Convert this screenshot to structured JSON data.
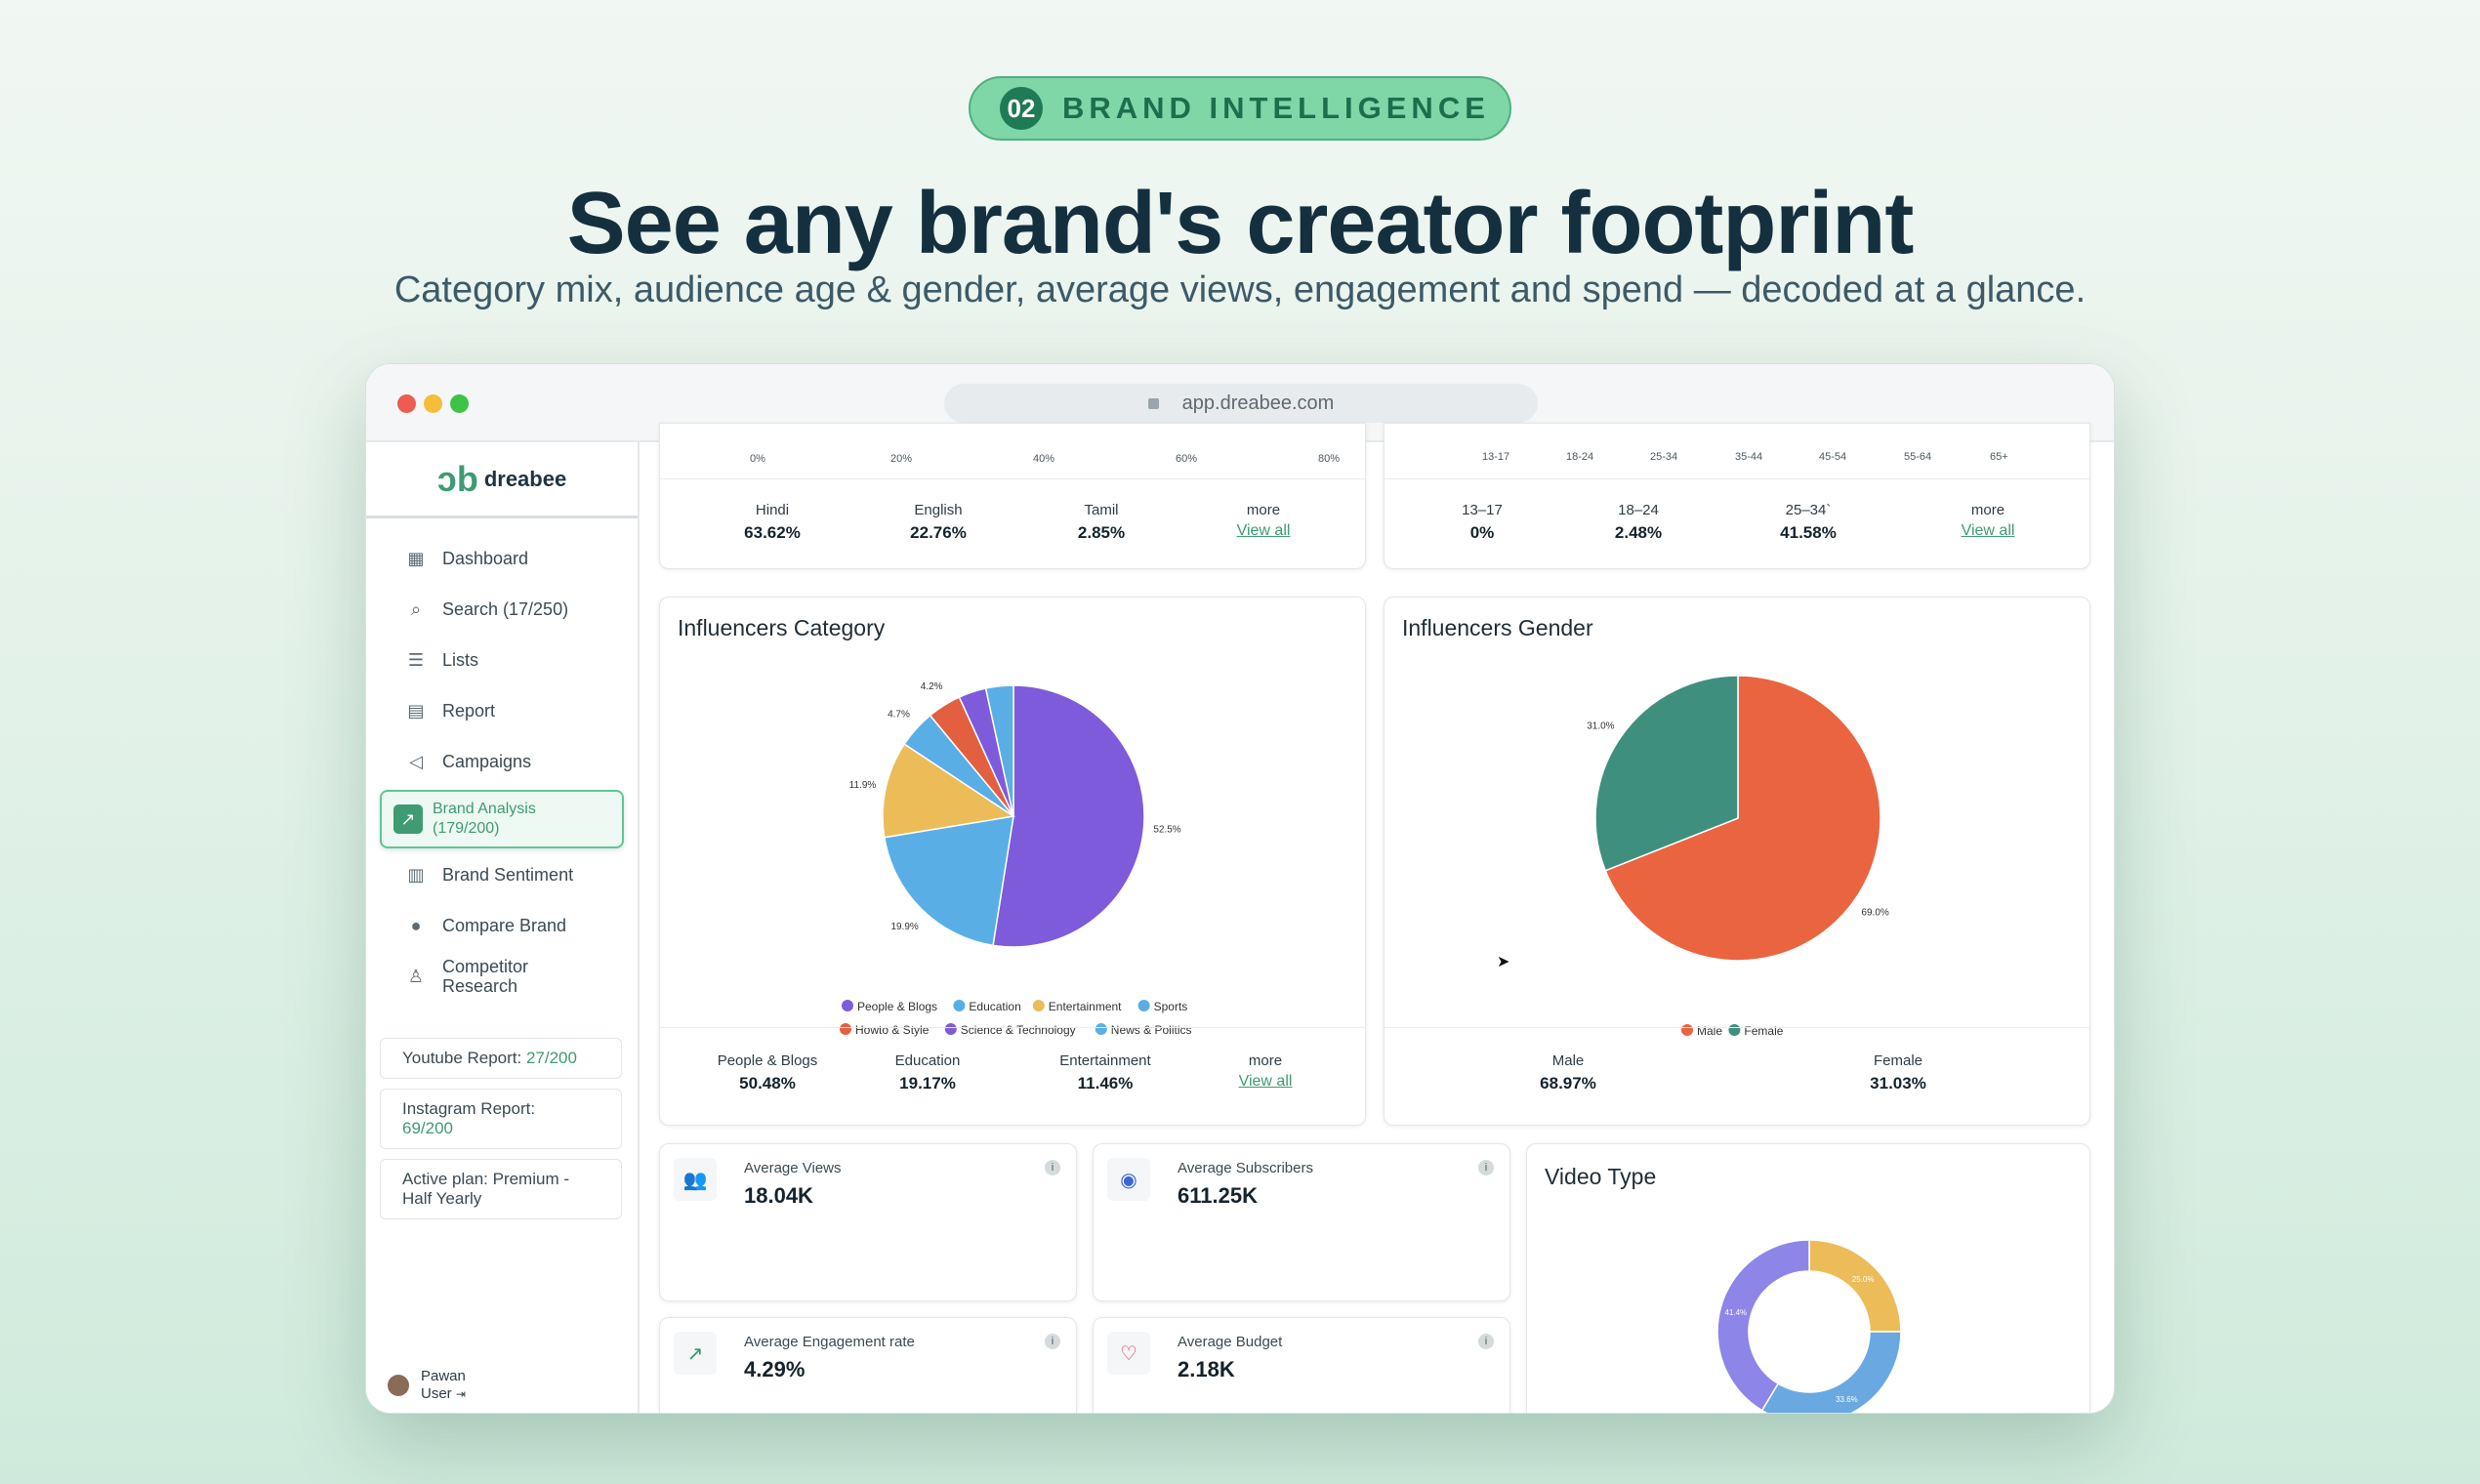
{
  "header": {
    "badge_num": "02",
    "badge_text": "BRAND INTELLIGENCE",
    "headline": "See any brand's creator footprint",
    "subheadline": "Category mix, audience age & gender, average views, engagement and spend — decoded at a glance."
  },
  "browser": {
    "url": "app.dreabee.com"
  },
  "sidebar": {
    "logo_word": "dreabee",
    "items": [
      {
        "label": "Dashboard",
        "icon": "dashboard-icon"
      },
      {
        "label": "Search (17/250)",
        "icon": "search-icon"
      },
      {
        "label": "Lists",
        "icon": "list-icon"
      },
      {
        "label": "Report",
        "icon": "report-icon"
      },
      {
        "label": "Campaigns",
        "icon": "megaphone-icon"
      },
      {
        "label": "Brand Analysis (179/200)",
        "icon": "chart-icon"
      },
      {
        "label": "Brand Sentiment",
        "icon": "sentiment-icon"
      },
      {
        "label": "Compare Brand",
        "icon": "compare-icon"
      },
      {
        "label": "Competitor Research",
        "icon": "research-icon"
      }
    ],
    "youtube_report_label": "Youtube Report: ",
    "youtube_report_value": "27/200",
    "instagram_report_label": "Instagram Report: ",
    "instagram_report_value": "69/200",
    "active_plan": "Active plan: Premium - Half Yearly",
    "user_name": "Pawan",
    "user_role": "User"
  },
  "language_panel": {
    "ticks": [
      "0%",
      "20%",
      "40%",
      "60%",
      "80%"
    ],
    "stats": [
      {
        "label": "Hindi",
        "value": "63.62%"
      },
      {
        "label": "English",
        "value": "22.76%"
      },
      {
        "label": "Tamil",
        "value": "2.85%"
      }
    ],
    "more": "more",
    "view_all": "View all"
  },
  "age_panel": {
    "ticks": [
      "13-17",
      "18-24",
      "25-34",
      "35-44",
      "45-54",
      "55-64",
      "65+"
    ],
    "stats": [
      {
        "label": "13–17",
        "value": "0%"
      },
      {
        "label": "18–24",
        "value": "2.48%"
      },
      {
        "label": "25–34`",
        "value": "41.58%"
      }
    ],
    "more": "more",
    "view_all": "View all"
  },
  "category_panel": {
    "title": "Influencers Category",
    "stats": [
      {
        "label": "People & Blogs",
        "value": "50.48%"
      },
      {
        "label": "Education",
        "value": "19.17%"
      },
      {
        "label": "Entertainment",
        "value": "11.46%"
      }
    ],
    "more": "more",
    "view_all": "View all"
  },
  "gender_panel": {
    "title": "Influencers Gender",
    "stats": [
      {
        "label": "Male",
        "value": "68.97%"
      },
      {
        "label": "Female",
        "value": "31.03%"
      }
    ]
  },
  "metrics": [
    {
      "label": "Average Views",
      "value": "18.04K",
      "icon": "users-icon"
    },
    {
      "label": "Average Subscribers",
      "value": "611.25K",
      "icon": "eye-icon"
    },
    {
      "label": "Average Engagement rate",
      "value": "4.29%",
      "icon": "trend-up-icon"
    },
    {
      "label": "Average Budget",
      "value": "2.18K",
      "icon": "heart-icon"
    }
  ],
  "video_panel": {
    "title": "Video Type"
  },
  "chart_data": [
    {
      "type": "pie",
      "title": "Influencers Category",
      "categories": [
        "People & Blogs",
        "Education",
        "Entertainment",
        "Sports",
        "Howto & Style",
        "Science & Technology",
        "News & Politics"
      ],
      "values": [
        52.5,
        19.9,
        11.9,
        4.7,
        4.2,
        3.4,
        3.4
      ],
      "data_labels": [
        "52.5%",
        "19.9%",
        "11.9%",
        "4.7%",
        "4.2%",
        "",
        ""
      ],
      "colors": [
        "#7e5bdb",
        "#5aaee6",
        "#ecbc59",
        "#5aaee6",
        "#e2603f",
        "#7e5bdb",
        "#5aaee6"
      ],
      "legend_colors": [
        "#7e5bdb",
        "#5aaee6",
        "#ecbc59",
        "#5aaee6",
        "#e2603f",
        "#7e5bdb",
        "#5aaee6"
      ],
      "legend": "bottom"
    },
    {
      "type": "pie",
      "title": "Influencers Gender",
      "categories": [
        "Male",
        "Female"
      ],
      "values": [
        69.0,
        31.0
      ],
      "data_labels": [
        "69.0%",
        "31.0%"
      ],
      "colors": [
        "#ea6440",
        "#3f8f7e"
      ],
      "legend": "bottom"
    },
    {
      "type": "pie",
      "title": "Video Type",
      "donut": true,
      "values": [
        25.0,
        33.6,
        41.4
      ],
      "data_labels": [
        "25.0%",
        "33.6%",
        "41.4%"
      ],
      "colors": [
        "#ecbc59",
        "#6aa8e2",
        "#8e85e8"
      ]
    }
  ]
}
